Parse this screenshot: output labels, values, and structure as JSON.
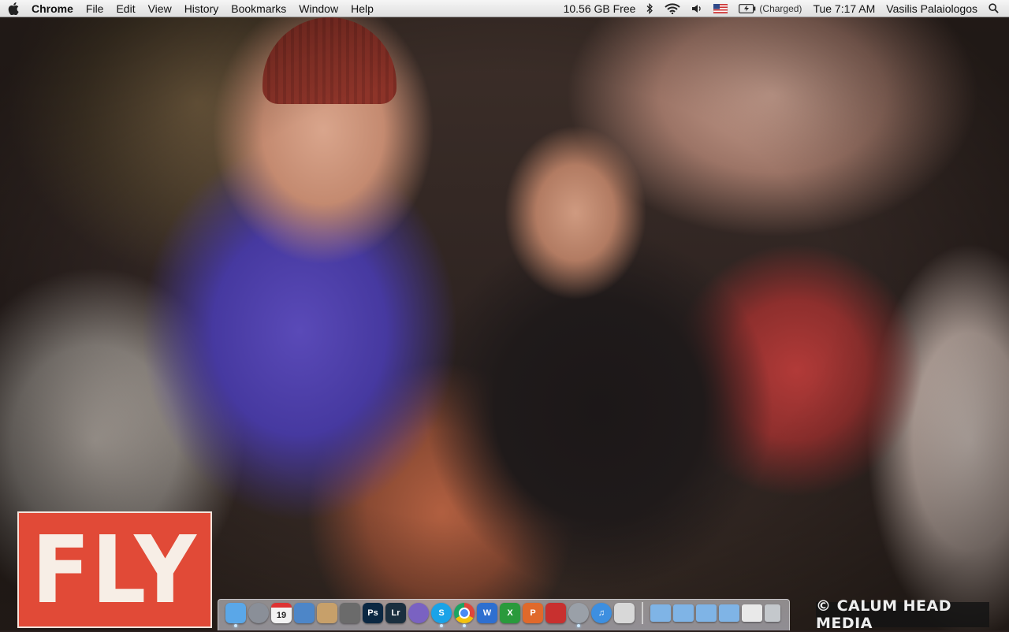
{
  "menubar": {
    "app_name": "Chrome",
    "menus": [
      "File",
      "Edit",
      "View",
      "History",
      "Bookmarks",
      "Window",
      "Help"
    ],
    "disk_free": "10.56 GB Free",
    "battery_status": "(Charged)",
    "clock": "Tue 7:17 AM",
    "user_name": "Vasilis Palaiologos",
    "status_icons": [
      "bluetooth-icon",
      "wifi-icon",
      "volume-icon",
      "us-flag-icon",
      "battery-icon"
    ]
  },
  "wallpaper": {
    "logo_text": "FLY",
    "watermark": "© CALUM HEAD MEDIA"
  },
  "dock": {
    "calendar_day": "19",
    "apps": [
      {
        "name": "finder",
        "label": "",
        "color": "#5aa7e8"
      },
      {
        "name": "launchpad",
        "label": "",
        "color": "#8a8f98"
      },
      {
        "name": "calendar",
        "label": "19",
        "color": "#f2f2f2"
      },
      {
        "name": "preview",
        "label": "",
        "color": "#4d86c8"
      },
      {
        "name": "contacts",
        "label": "",
        "color": "#c7a06a"
      },
      {
        "name": "photo-booth",
        "label": "",
        "color": "#6b6b6b"
      },
      {
        "name": "photoshop",
        "label": "Ps",
        "color": "#0b2742"
      },
      {
        "name": "lightroom",
        "label": "Lr",
        "color": "#1b2f3f"
      },
      {
        "name": "disc-app",
        "label": "",
        "color": "#7a62c2"
      },
      {
        "name": "skype",
        "label": "S",
        "color": "#1aa3e8"
      },
      {
        "name": "chrome",
        "label": "",
        "color": "#e0463b"
      },
      {
        "name": "word",
        "label": "W",
        "color": "#2e6fd0"
      },
      {
        "name": "excel",
        "label": "X",
        "color": "#2a9a3c"
      },
      {
        "name": "powerpoint",
        "label": "P",
        "color": "#e0692b"
      },
      {
        "name": "filezilla",
        "label": "",
        "color": "#c8302f"
      },
      {
        "name": "disk-utility",
        "label": "",
        "color": "#9aa0a8"
      },
      {
        "name": "itunes",
        "label": "♫",
        "color": "#3d8fe0"
      },
      {
        "name": "system-app",
        "label": "",
        "color": "#d8d8d8"
      }
    ],
    "stacks": [
      {
        "name": "applications-folder",
        "color": "#7fb4e6"
      },
      {
        "name": "documents-folder",
        "color": "#7fb4e6"
      },
      {
        "name": "music-folder",
        "color": "#7fb4e6"
      },
      {
        "name": "pictures-folder",
        "color": "#7fb4e6"
      },
      {
        "name": "downloads-stack",
        "color": "#e9e9e9"
      },
      {
        "name": "trash",
        "color": "#c4c8cc"
      }
    ],
    "running": [
      "finder",
      "skype",
      "chrome",
      "disk-utility"
    ]
  }
}
